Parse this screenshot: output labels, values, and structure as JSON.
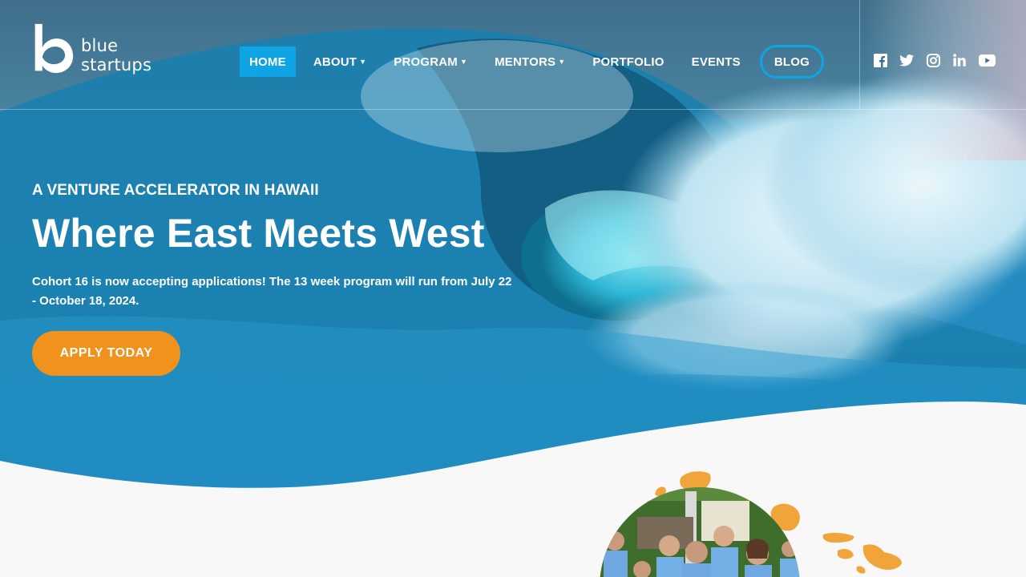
{
  "brand": {
    "name": "blue startups"
  },
  "nav": {
    "items": [
      {
        "label": "HOME",
        "active": true,
        "dropdown": false
      },
      {
        "label": "ABOUT",
        "active": false,
        "dropdown": true
      },
      {
        "label": "PROGRAM",
        "active": false,
        "dropdown": true
      },
      {
        "label": "MENTORS",
        "active": false,
        "dropdown": true
      },
      {
        "label": "PORTFOLIO",
        "active": false,
        "dropdown": false
      },
      {
        "label": "EVENTS",
        "active": false,
        "dropdown": false
      },
      {
        "label": "BLOG",
        "active": false,
        "dropdown": false
      }
    ],
    "caret": "▼"
  },
  "social": {
    "icons": [
      "facebook-icon",
      "twitter-icon",
      "instagram-icon",
      "linkedin-icon",
      "youtube-icon"
    ]
  },
  "hero": {
    "eyebrow": "A VENTURE ACCELERATOR IN HAWAII",
    "headline": "Where East Meets West",
    "blurb": "Cohort 16 is now accepting applications! The 13 week program will run from July 22 - October 18, 2024.",
    "cta_label": "APPLY TODAY"
  },
  "colors": {
    "accent_blue": "#0fa4e3",
    "cta_orange": "#f0921b",
    "island_orange": "#f0a43a",
    "page_bg": "#f8f8f8"
  }
}
